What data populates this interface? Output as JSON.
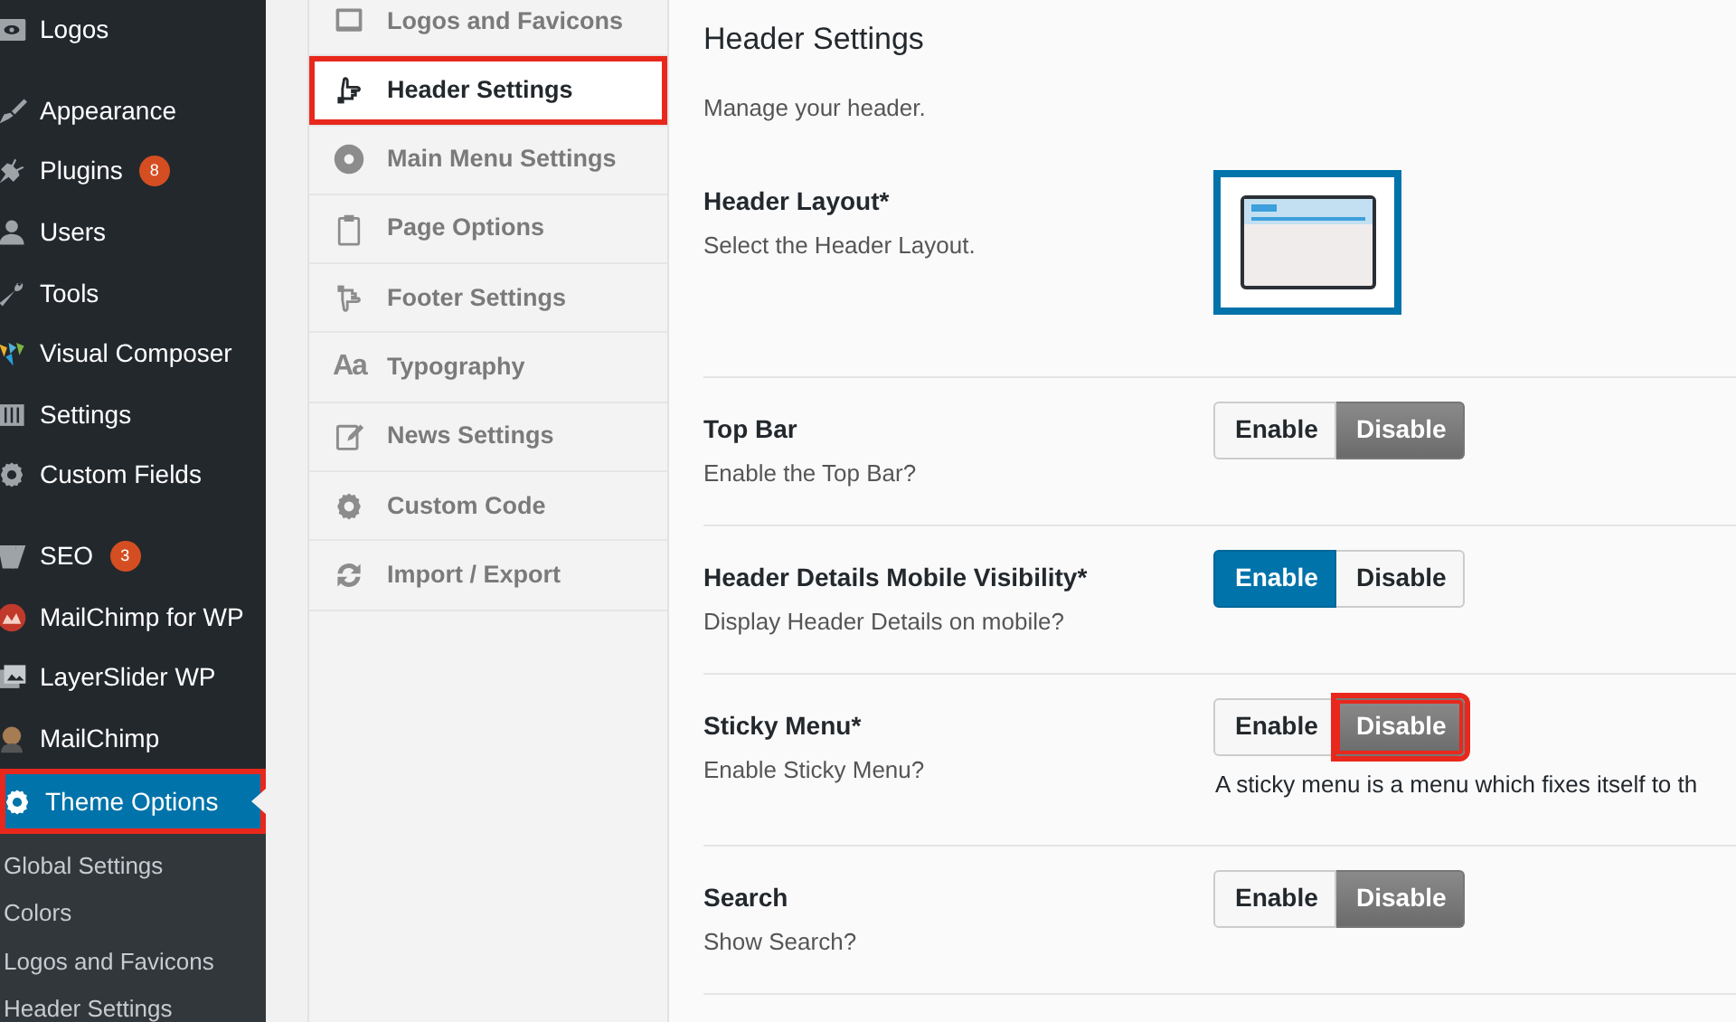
{
  "admin_menu": {
    "groups": [
      {
        "items": [
          {
            "label": "Logos",
            "selected": false,
            "highlighted": false
          }
        ]
      },
      {
        "items": [
          {
            "label": "Appearance",
            "selected": false,
            "highlighted": false
          },
          {
            "label": "Plugins",
            "badge": "8",
            "selected": false,
            "highlighted": false
          },
          {
            "label": "Users",
            "selected": false,
            "highlighted": false
          },
          {
            "label": "Tools",
            "selected": false,
            "highlighted": false
          },
          {
            "label": "Visual Composer",
            "selected": false,
            "highlighted": false
          },
          {
            "label": "Settings",
            "selected": false,
            "highlighted": false
          },
          {
            "label": "Custom Fields",
            "selected": false,
            "highlighted": false
          }
        ]
      },
      {
        "items": [
          {
            "label": "SEO",
            "badge": "3",
            "selected": false,
            "highlighted": false
          },
          {
            "label": "MailChimp for WP",
            "selected": false,
            "highlighted": false
          },
          {
            "label": "LayerSlider WP",
            "selected": false,
            "highlighted": false
          },
          {
            "label": "MailChimp",
            "selected": false,
            "highlighted": false
          },
          {
            "label": "Theme Options",
            "selected": true,
            "highlighted": true
          }
        ]
      }
    ],
    "submenu": [
      "Global Settings",
      "Colors",
      "Logos and Favicons",
      "Header Settings"
    ]
  },
  "tabs": [
    {
      "label": "Logos and Favicons",
      "selected": false,
      "highlighted": false
    },
    {
      "label": "Header Settings",
      "selected": true,
      "highlighted": true
    },
    {
      "label": "Main Menu Settings",
      "selected": false,
      "highlighted": false
    },
    {
      "label": "Page Options",
      "selected": false,
      "highlighted": false
    },
    {
      "label": "Footer Settings",
      "selected": false,
      "highlighted": false
    },
    {
      "label": "Typography",
      "glyph": "Aa",
      "selected": false,
      "highlighted": false
    },
    {
      "label": "News Settings",
      "selected": false,
      "highlighted": false
    },
    {
      "label": "Custom Code",
      "selected": false,
      "highlighted": false
    },
    {
      "label": "Import / Export",
      "selected": false,
      "highlighted": false
    }
  ],
  "panel": {
    "title": "Header Settings",
    "description": "Manage your header."
  },
  "settings": [
    {
      "kind": "layout",
      "title": "Header Layout*",
      "description": "Select the Header Layout.",
      "options": [
        {
          "selected": true
        }
      ]
    },
    {
      "kind": "toggle",
      "title": "Top Bar",
      "description": "Enable the Top Bar?",
      "options": [
        {
          "label": "Enable",
          "selected": false,
          "highlighted": false
        },
        {
          "label": "Disable",
          "selected": true,
          "highlighted": false
        }
      ]
    },
    {
      "kind": "toggle",
      "title": "Header Details Mobile Visibility*",
      "description": "Display Header Details on mobile?",
      "options": [
        {
          "label": "Enable",
          "selected": true,
          "highlighted": false
        },
        {
          "label": "Disable",
          "selected": false,
          "highlighted": false
        }
      ]
    },
    {
      "kind": "toggle",
      "title": "Sticky Menu*",
      "description": "Enable Sticky Menu?",
      "options": [
        {
          "label": "Enable",
          "selected": false,
          "highlighted": false
        },
        {
          "label": "Disable",
          "selected": true,
          "highlighted": true
        }
      ],
      "note": "A sticky menu is a menu which fixes itself to th"
    },
    {
      "kind": "toggle",
      "title": "Search",
      "description": "Show Search?",
      "options": [
        {
          "label": "Enable",
          "selected": false,
          "highlighted": false
        },
        {
          "label": "Disable",
          "selected": true,
          "highlighted": false
        }
      ]
    }
  ]
}
